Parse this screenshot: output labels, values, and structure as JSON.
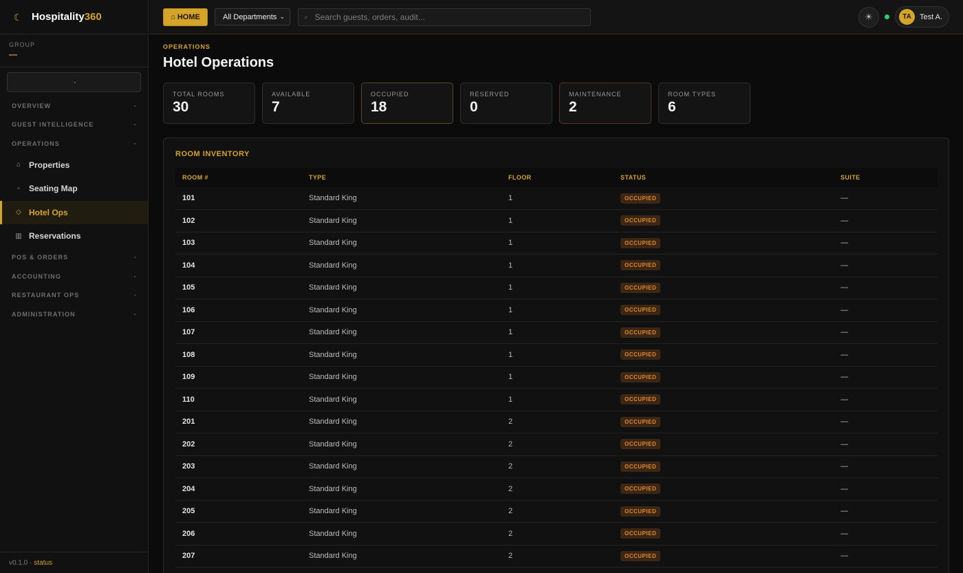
{
  "brand": {
    "name": "Hospitality",
    "accent": "360",
    "logo_icon": "crescent-logo"
  },
  "sidebar": {
    "group_label": "GROUP",
    "group_value": "—",
    "sections": {
      "overview": "OVERVIEW",
      "guest_intelligence": "GUEST INTELLIGENCE",
      "operations": "OPERATIONS",
      "pos_orders": "POS & ORDERS",
      "accounting": "ACCOUNTING",
      "restaurant_ops": "RESTAURANT OPS",
      "administration": "ADMINISTRATION"
    },
    "items": [
      {
        "label": "Properties",
        "icon": "⌂"
      },
      {
        "label": "Seating Map",
        "icon": "▫"
      },
      {
        "label": "Hotel Ops",
        "icon": "◇"
      },
      {
        "label": "Reservations",
        "icon": "▥"
      }
    ],
    "footer_version": "v0.1.0 ·",
    "footer_status": "status"
  },
  "topbar": {
    "home_label": "⌂ HOME",
    "department": "All Departments",
    "search_placeholder": "Search guests, orders, audit...",
    "user_initials": "TA",
    "user_name": "Test A."
  },
  "main": {
    "eyebrow": "OPERATIONS",
    "title": "Hotel Operations",
    "stats": [
      {
        "label": "TOTAL ROOMS",
        "value": "30"
      },
      {
        "label": "AVAILABLE",
        "value": "7"
      },
      {
        "label": "OCCUPIED",
        "value": "18"
      },
      {
        "label": "RESERVED",
        "value": "0"
      },
      {
        "label": "MAINTENANCE",
        "value": "2"
      },
      {
        "label": "ROOM TYPES",
        "value": "6"
      }
    ],
    "inventory": {
      "title": "ROOM INVENTORY",
      "columns": [
        "ROOM #",
        "TYPE",
        "FLOOR",
        "STATUS",
        "SUITE"
      ],
      "rows": [
        {
          "room": "101",
          "type": "Standard King",
          "floor": "1",
          "status": "OCCUPIED",
          "suite": "—"
        },
        {
          "room": "102",
          "type": "Standard King",
          "floor": "1",
          "status": "OCCUPIED",
          "suite": "—"
        },
        {
          "room": "103",
          "type": "Standard King",
          "floor": "1",
          "status": "OCCUPIED",
          "suite": "—"
        },
        {
          "room": "104",
          "type": "Standard King",
          "floor": "1",
          "status": "OCCUPIED",
          "suite": "—"
        },
        {
          "room": "105",
          "type": "Standard King",
          "floor": "1",
          "status": "OCCUPIED",
          "suite": "—"
        },
        {
          "room": "106",
          "type": "Standard King",
          "floor": "1",
          "status": "OCCUPIED",
          "suite": "—"
        },
        {
          "room": "107",
          "type": "Standard King",
          "floor": "1",
          "status": "OCCUPIED",
          "suite": "—"
        },
        {
          "room": "108",
          "type": "Standard King",
          "floor": "1",
          "status": "OCCUPIED",
          "suite": "—"
        },
        {
          "room": "109",
          "type": "Standard King",
          "floor": "1",
          "status": "OCCUPIED",
          "suite": "—"
        },
        {
          "room": "110",
          "type": "Standard King",
          "floor": "1",
          "status": "OCCUPIED",
          "suite": "—"
        },
        {
          "room": "201",
          "type": "Standard King",
          "floor": "2",
          "status": "OCCUPIED",
          "suite": "—"
        },
        {
          "room": "202",
          "type": "Standard King",
          "floor": "2",
          "status": "OCCUPIED",
          "suite": "—"
        },
        {
          "room": "203",
          "type": "Standard King",
          "floor": "2",
          "status": "OCCUPIED",
          "suite": "—"
        },
        {
          "room": "204",
          "type": "Standard King",
          "floor": "2",
          "status": "OCCUPIED",
          "suite": "—"
        },
        {
          "room": "205",
          "type": "Standard King",
          "floor": "2",
          "status": "OCCUPIED",
          "suite": "—"
        },
        {
          "room": "206",
          "type": "Standard King",
          "floor": "2",
          "status": "OCCUPIED",
          "suite": "—"
        },
        {
          "room": "207",
          "type": "Standard King",
          "floor": "2",
          "status": "OCCUPIED",
          "suite": "—"
        }
      ]
    }
  },
  "colors": {
    "accent": "#d4a52a",
    "background": "#0b0b0b",
    "online": "#2ecc71",
    "badge_text": "#e0862b"
  }
}
